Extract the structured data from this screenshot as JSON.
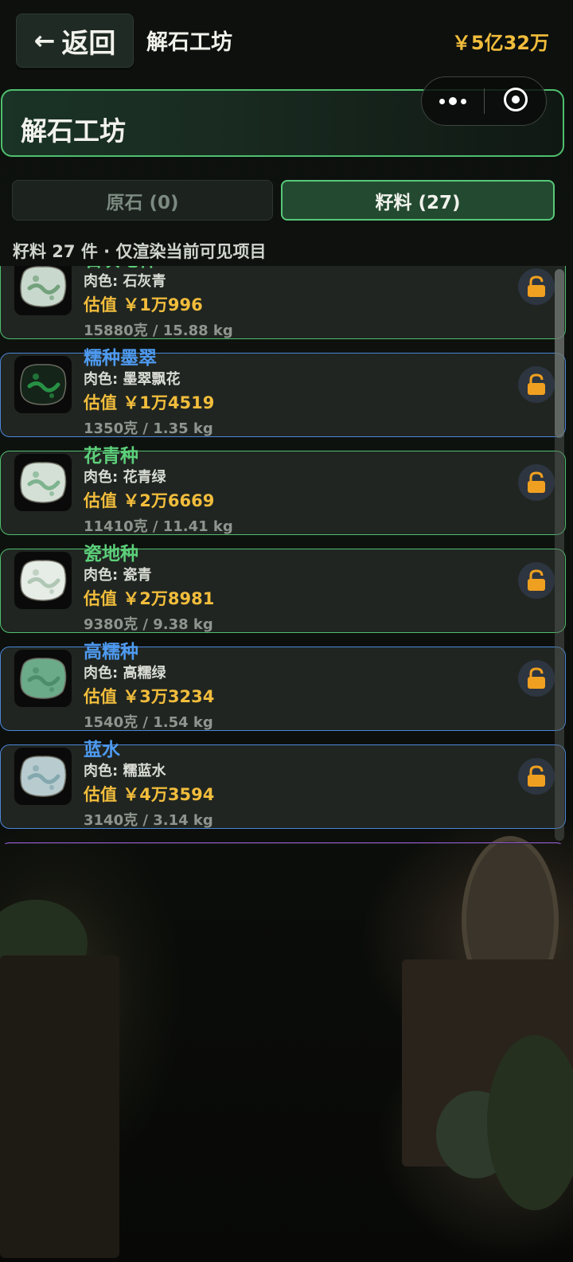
{
  "topbar": {
    "back_label": "返回",
    "title": "解石工坊",
    "balance": "￥5亿32万"
  },
  "header": {
    "title": "解石工坊"
  },
  "capsule": {
    "more_icon": "more-dots-icon",
    "close_icon": "target-circle-icon"
  },
  "tabs": [
    {
      "label": "原石 (0)",
      "active": false
    },
    {
      "label": "籽料 (27)",
      "active": true
    }
  ],
  "summary": "籽料 27 件 · 仅渲染当前可见项目",
  "items": [
    {
      "name": "石灰地种",
      "flesh": "肉色: 石灰青",
      "value": "估值 ￥1万996",
      "weight": "15880克 / 15.88 kg",
      "rarity_color": "#4fbf6e",
      "stone_color": "#c8d8cc",
      "vein_color": "#4f8a5a",
      "lock_icon": "unlock-icon"
    },
    {
      "name": "糯种墨翠",
      "flesh": "肉色: 墨翠飘花",
      "value": "估值 ￥1万4519",
      "weight": "1350克 / 1.35 kg",
      "rarity_color": "#4b86d8",
      "stone_color": "#142418",
      "vein_color": "#2fbf58",
      "lock_icon": "unlock-icon"
    },
    {
      "name": "花青种",
      "flesh": "肉色: 花青绿",
      "value": "估值 ￥2万6669",
      "weight": "11410克 / 11.41 kg",
      "rarity_color": "#4fbf6e",
      "stone_color": "#d4e0d6",
      "vein_color": "#5aa070",
      "lock_icon": "unlock-icon"
    },
    {
      "name": "瓷地种",
      "flesh": "肉色: 瓷青",
      "value": "估值 ￥2万8981",
      "weight": "9380克 / 9.38 kg",
      "rarity_color": "#4fbf6e",
      "stone_color": "#e6ece6",
      "vein_color": "#9ab8a0",
      "lock_icon": "unlock-icon"
    },
    {
      "name": "高糯种",
      "flesh": "肉色: 高糯绿",
      "value": "估值 ￥3万3234",
      "weight": "1540克 / 1.54 kg",
      "rarity_color": "#4b86d8",
      "stone_color": "#6cab8a",
      "vein_color": "#3e8060",
      "lock_icon": "unlock-icon"
    },
    {
      "name": "蓝水",
      "flesh": "肉色: 糯蓝水",
      "value": "估值 ￥4万3594",
      "weight": "3140克 / 3.14 kg",
      "rarity_color": "#4b86d8",
      "stone_color": "#b8ccd0",
      "vein_color": "#6e98a0",
      "lock_icon": "unlock-icon"
    }
  ]
}
